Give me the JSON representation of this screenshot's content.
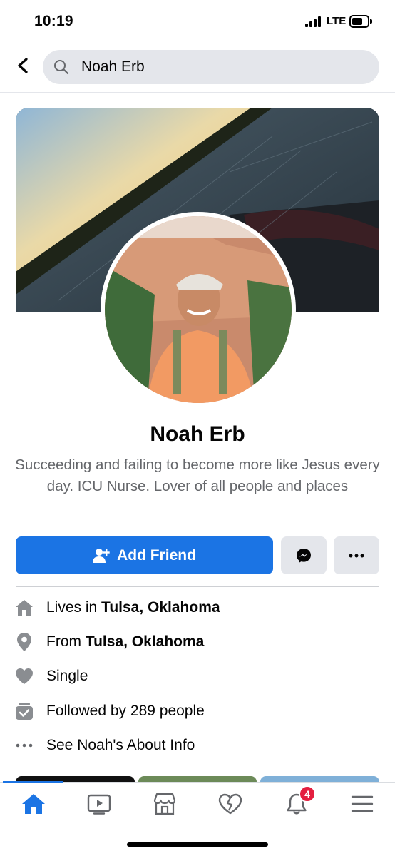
{
  "status_bar": {
    "time": "10:19",
    "network": "LTE"
  },
  "search": {
    "query": "Noah Erb"
  },
  "profile": {
    "name": "Noah Erb",
    "bio": "Succeeding and failing to become more like Jesus every day. ICU Nurse. Lover of all people and places"
  },
  "actions": {
    "add_friend_label": "Add Friend"
  },
  "intro": [
    {
      "icon": "home-icon",
      "prefix": "Lives in ",
      "bold": "Tulsa, Oklahoma"
    },
    {
      "icon": "location-pin-icon",
      "prefix": "From ",
      "bold": "Tulsa, Oklahoma"
    },
    {
      "icon": "heart-icon",
      "prefix": "Single",
      "bold": ""
    },
    {
      "icon": "followers-icon",
      "prefix": "Followed by 289 people",
      "bold": ""
    },
    {
      "icon": "more-dots-icon",
      "prefix": "See Noah's About Info",
      "bold": ""
    }
  ],
  "tabbar": {
    "tabs": [
      "home-icon",
      "watch-icon",
      "marketplace-icon",
      "dating-icon",
      "notifications-icon",
      "menu-icon"
    ],
    "active": "home-icon",
    "notifications_badge": "4"
  },
  "colors": {
    "accent": "#1b74e4",
    "badge": "#e41e3f",
    "button_gray": "#e4e6eb"
  }
}
